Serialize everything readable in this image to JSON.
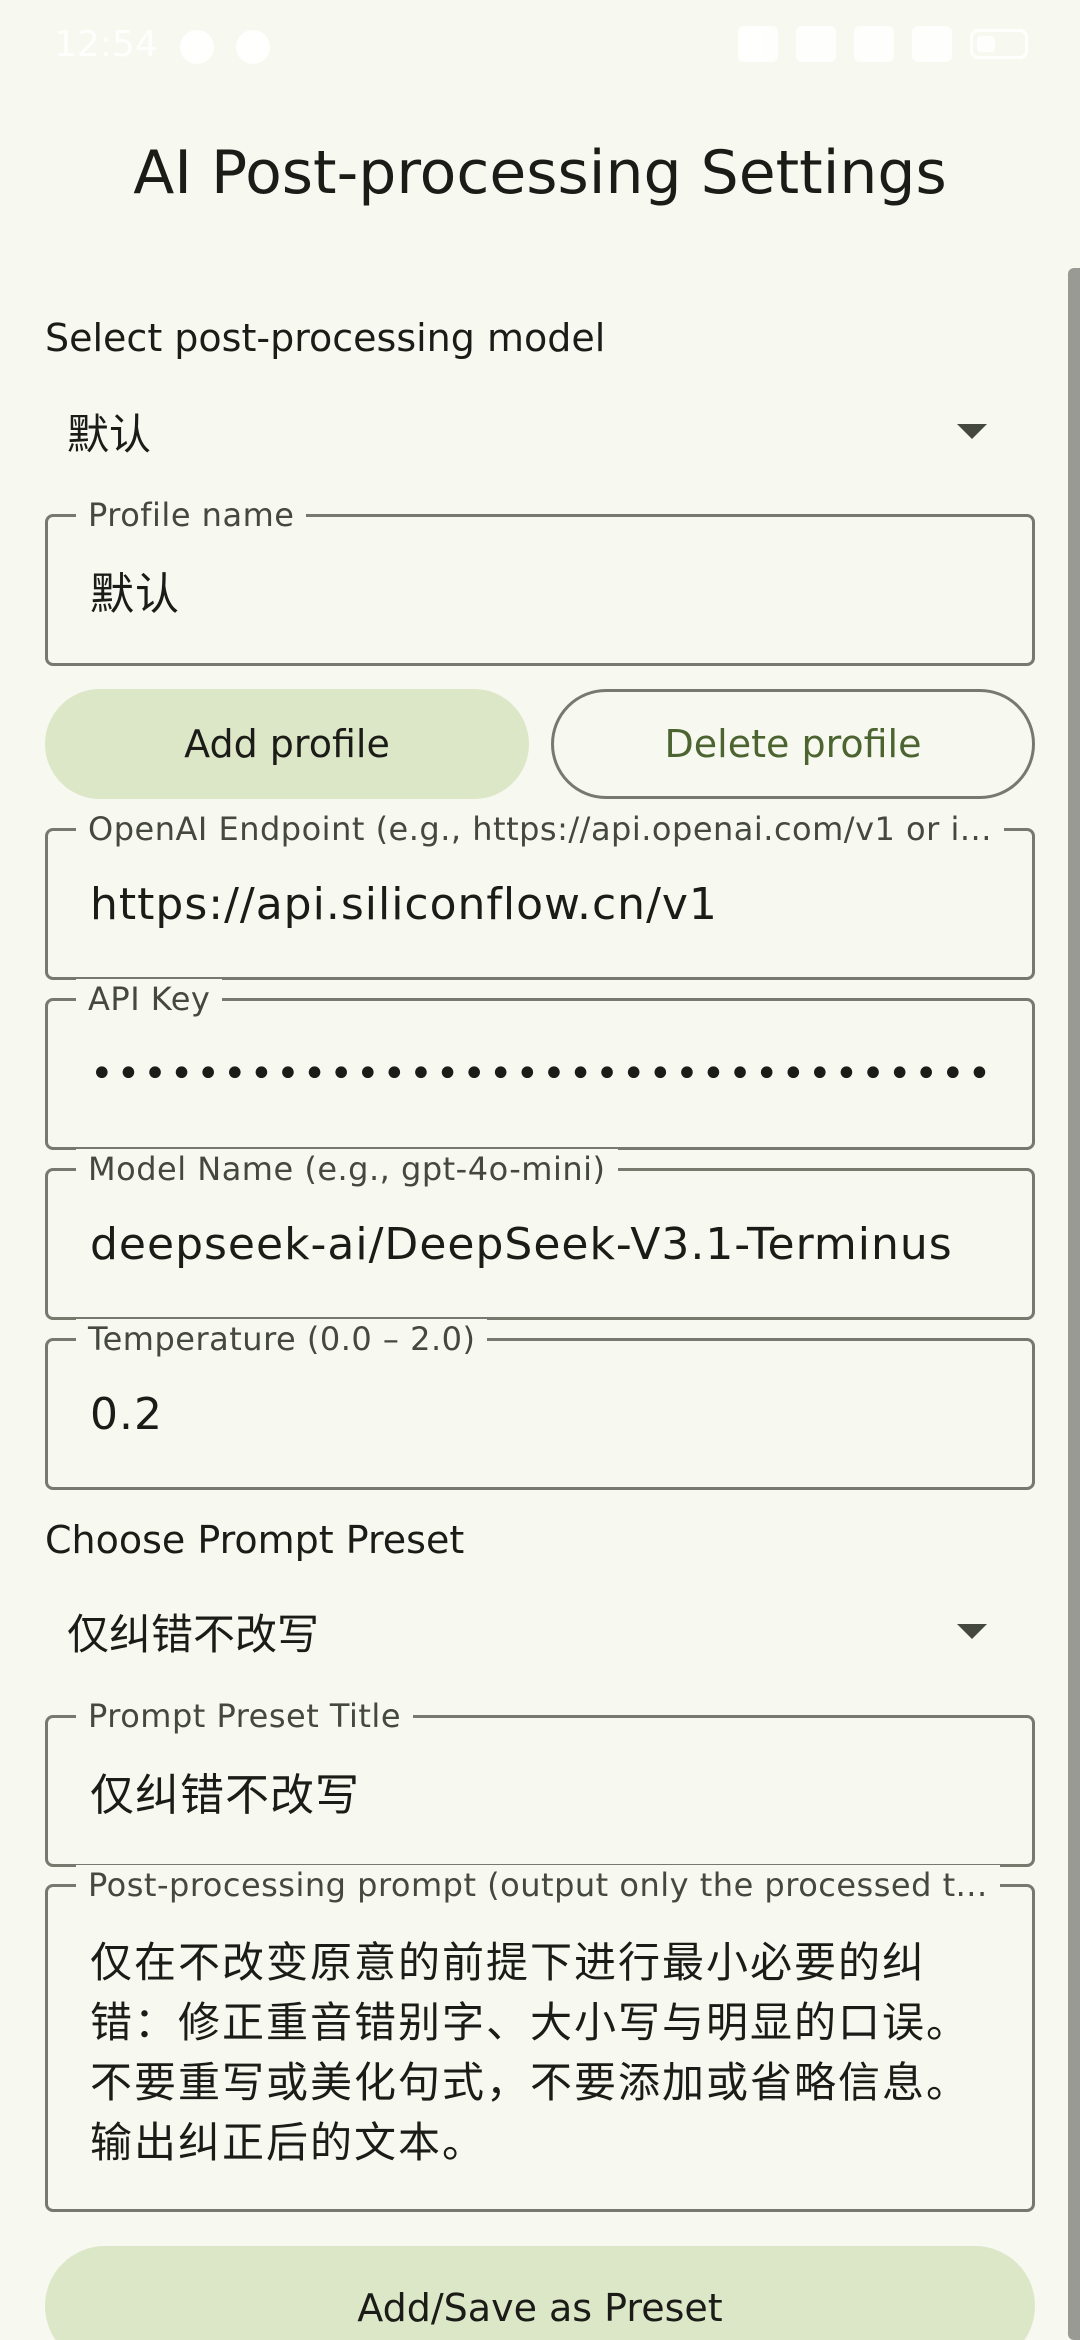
{
  "status_bar": {
    "time": "12:54"
  },
  "page": {
    "title": "AI Post-processing Settings"
  },
  "model_section": {
    "label": "Select post-processing model",
    "selected": "默认"
  },
  "profile_name": {
    "label": "Profile name",
    "value": "默认"
  },
  "buttons": {
    "add_profile": "Add profile",
    "delete_profile": "Delete profile",
    "save_preset": "Add/Save as Preset"
  },
  "endpoint": {
    "label": "OpenAI Endpoint (e.g., https://api.openai.com/v1 or i...",
    "value": "https://api.siliconflow.cn/v1"
  },
  "api_key": {
    "label": "API Key",
    "value": "••••••••••••••••••••••••••••••••••••••••••••••"
  },
  "model_name": {
    "label": "Model Name (e.g., gpt-4o-mini)",
    "value": "deepseek-ai/DeepSeek-V3.1-Terminus"
  },
  "temperature": {
    "label": "Temperature (0.0 – 2.0)",
    "value": "0.2"
  },
  "preset_section": {
    "label": "Choose Prompt Preset",
    "selected": "仅纠错不改写"
  },
  "preset_title": {
    "label": "Prompt Preset Title",
    "value": "仅纠错不改写"
  },
  "prompt": {
    "label": "Post-processing prompt (output only the processed t...",
    "value": "仅在不改变原意的前提下进行最小必要的纠错：修正重音错别字、大小写与明显的口误。不要重写或美化句式，不要添加或省略信息。输出纠正后的文本。"
  }
}
